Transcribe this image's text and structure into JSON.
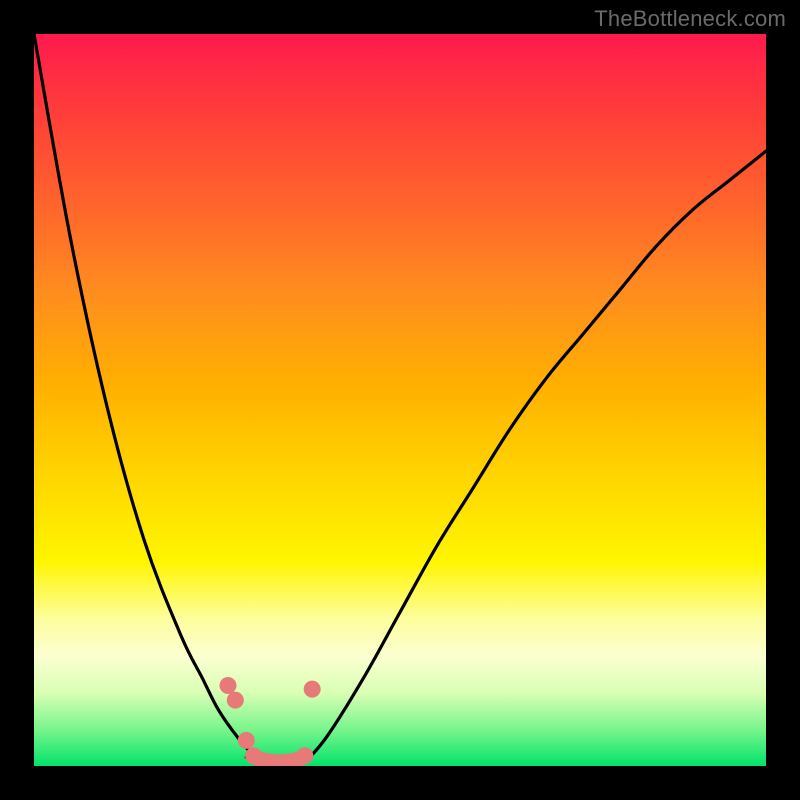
{
  "watermark": {
    "text": "TheBottleneck.com"
  },
  "colors": {
    "gradient_top": "#ff1a4d",
    "gradient_mid": "#ffd400",
    "gradient_bottom": "#03e26a",
    "frame": "#000000",
    "curve": "#000000",
    "dots": "#e77a78"
  },
  "chart_data": {
    "type": "line",
    "title": "",
    "xlabel": "",
    "ylabel": "",
    "xlim": [
      0,
      100
    ],
    "ylim": [
      0,
      100
    ],
    "grid": false,
    "legend": false,
    "series": [
      {
        "name": "left-curve",
        "x": [
          0,
          5,
          10,
          15,
          20,
          23,
          25,
          27,
          29,
          31
        ],
        "values": [
          100,
          72,
          49,
          31,
          18,
          12,
          8,
          5,
          2.5,
          0.5
        ]
      },
      {
        "name": "right-curve",
        "x": [
          37,
          40,
          45,
          50,
          55,
          60,
          65,
          70,
          75,
          80,
          85,
          90,
          95,
          100
        ],
        "values": [
          0.5,
          4,
          12,
          21,
          30,
          38,
          46,
          53,
          59,
          65,
          71,
          76,
          80,
          84
        ]
      },
      {
        "name": "floor-bridge",
        "x": [
          29,
          31,
          33,
          35,
          37
        ],
        "values": [
          1.2,
          0.3,
          0.2,
          0.3,
          1.2
        ]
      }
    ],
    "dots": {
      "name": "highlight-dots",
      "x": [
        26.5,
        27.5,
        29,
        30,
        31,
        32,
        33,
        34,
        35,
        36,
        37,
        38
      ],
      "values": [
        11,
        9,
        3.5,
        1.4,
        0.8,
        0.6,
        0.5,
        0.5,
        0.6,
        0.8,
        1.4,
        10.5
      ]
    }
  }
}
